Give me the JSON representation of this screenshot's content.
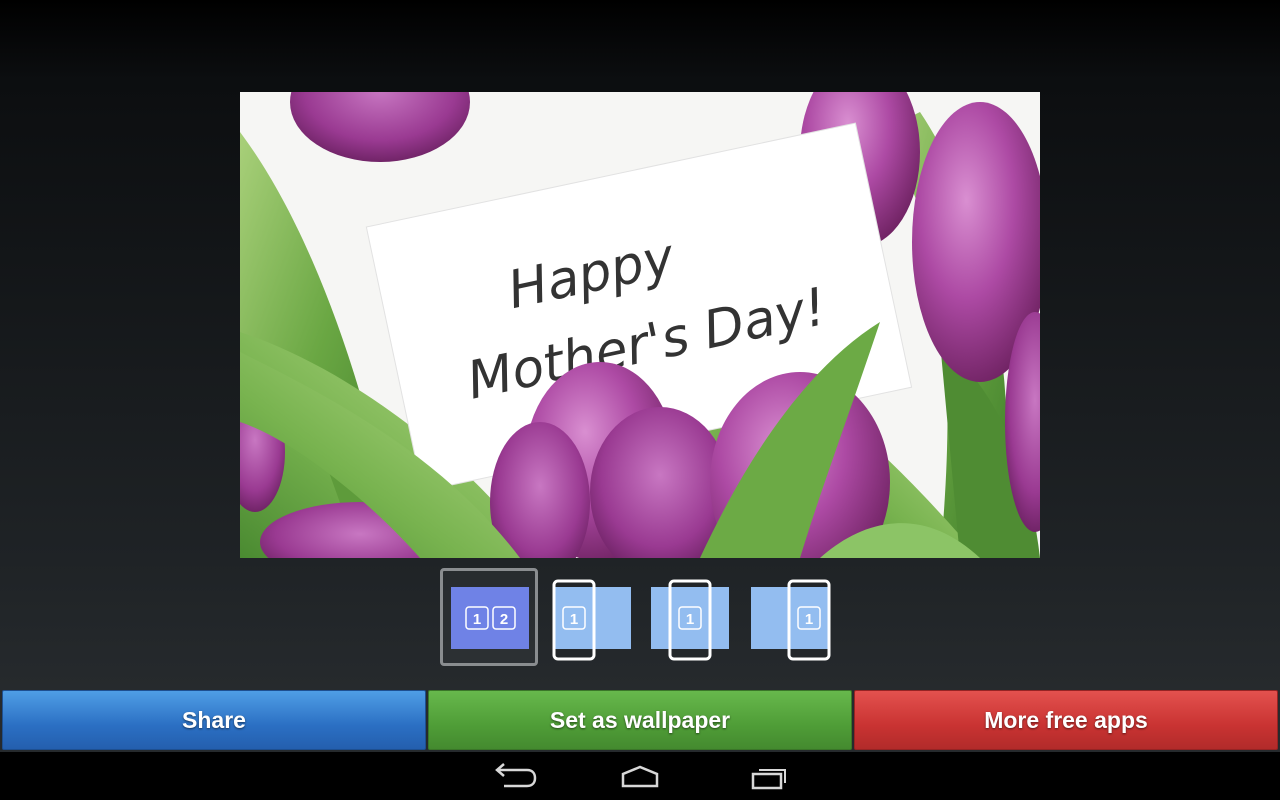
{
  "preview": {
    "card_line1": "Happy",
    "card_line2": "Mother's Day!"
  },
  "wallpaper_modes": [
    {
      "labels": [
        "1",
        "2"
      ],
      "selected": true
    },
    {
      "labels": [
        "1"
      ],
      "selected": false
    },
    {
      "labels": [
        "1"
      ],
      "selected": false
    },
    {
      "labels": [
        "1"
      ],
      "selected": false
    }
  ],
  "actions": {
    "share_label": "Share",
    "set_wallpaper_label": "Set as wallpaper",
    "more_apps_label": "More free apps"
  },
  "colors": {
    "share": "#2f7fd1",
    "set_wallpaper": "#55a63c",
    "more_apps": "#d63d3b",
    "mode_selected_fill": "#6f82e6",
    "mode_fill": "#93bdf0"
  },
  "navbar": {
    "icons": [
      "back-icon",
      "home-icon",
      "recents-icon"
    ]
  }
}
